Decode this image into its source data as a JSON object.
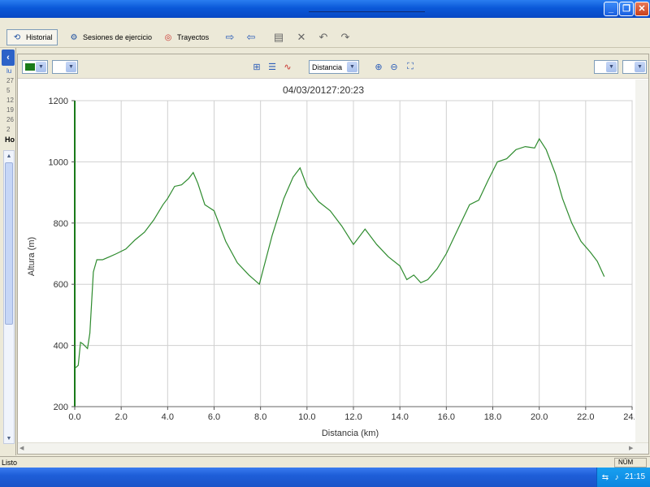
{
  "window": {
    "title": "",
    "controls": [
      "minimize",
      "maximize",
      "close"
    ]
  },
  "toolbar": {
    "buttons": [
      {
        "label": "Historial",
        "icon": "history-icon",
        "active": true
      },
      {
        "label": "Sesiones de ejercicio",
        "icon": "sessions-icon",
        "active": false
      },
      {
        "label": "Trayectos",
        "icon": "routes-icon",
        "active": false
      }
    ],
    "icon_buttons": [
      "import-icon",
      "export-icon",
      "copy-icon",
      "delete-icon",
      "undo-icon",
      "redo-icon"
    ]
  },
  "left_panel": {
    "lines": [
      "lu",
      "27",
      "5",
      "12",
      "19",
      "26",
      "2"
    ],
    "bold_text": "Ho"
  },
  "chart_toolbar": {
    "xaxis_select": "Distancia",
    "series_color": "#1a7a1a"
  },
  "chart_data": {
    "type": "line",
    "title": "04/03/20127:20:23",
    "xlabel": "Distancia (km)",
    "ylabel": "Altura (m)",
    "xlim": [
      0,
      24
    ],
    "ylim": [
      200,
      1200
    ],
    "xticks": [
      "0.0",
      "2.0",
      "4.0",
      "6.0",
      "8.0",
      "10.0",
      "12.0",
      "14.0",
      "16.0",
      "18.0",
      "20.0",
      "22.0",
      "24.0"
    ],
    "yticks": [
      "200",
      "400",
      "600",
      "800",
      "1000",
      "1200"
    ],
    "grid": true,
    "series": [
      {
        "color": "#2e8b2e",
        "x": [
          0.0,
          0.15,
          0.25,
          0.35,
          0.55,
          0.65,
          0.8,
          0.95,
          1.2,
          1.5,
          1.8,
          2.2,
          2.6,
          3.0,
          3.4,
          3.8,
          4.0,
          4.3,
          4.6,
          4.9,
          5.1,
          5.3,
          5.6,
          6.0,
          6.5,
          7.0,
          7.5,
          7.95,
          8.5,
          9.0,
          9.4,
          9.7,
          10.0,
          10.5,
          11.0,
          11.5,
          12.0,
          12.5,
          13.0,
          13.5,
          14.0,
          14.3,
          14.6,
          14.9,
          15.2,
          15.6,
          16.0,
          16.5,
          17.0,
          17.4,
          17.8,
          18.2,
          18.6,
          19.0,
          19.4,
          19.8,
          20.0,
          20.3,
          20.7,
          21.0,
          21.4,
          21.8,
          22.2,
          22.5,
          22.8
        ],
        "y": [
          325,
          335,
          410,
          405,
          390,
          440,
          640,
          680,
          680,
          690,
          700,
          715,
          745,
          770,
          810,
          860,
          880,
          920,
          925,
          945,
          965,
          930,
          860,
          840,
          740,
          670,
          630,
          600,
          760,
          880,
          950,
          980,
          920,
          870,
          840,
          790,
          730,
          780,
          730,
          690,
          660,
          615,
          630,
          605,
          615,
          650,
          700,
          780,
          860,
          875,
          940,
          1000,
          1010,
          1040,
          1050,
          1045,
          1075,
          1040,
          960,
          880,
          800,
          740,
          705,
          675,
          625
        ]
      }
    ]
  },
  "status": {
    "left": "Listo",
    "right": "NÚM"
  },
  "taskbar": {
    "clock": "21:15"
  }
}
